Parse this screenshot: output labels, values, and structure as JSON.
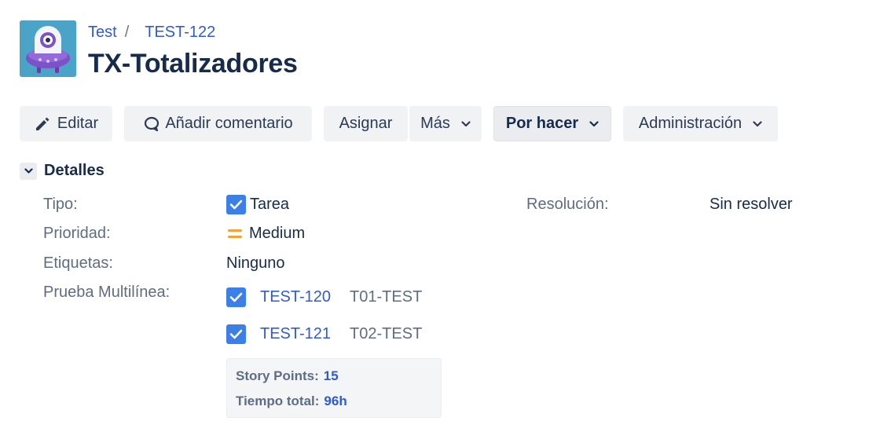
{
  "project": {
    "avatar_icon": "project-avatar-icon"
  },
  "breadcrumb": {
    "project": "Test",
    "issue_key": "TEST-122"
  },
  "issue": {
    "title": "TX-Totalizadores"
  },
  "toolbar": {
    "edit_label": "Editar",
    "comment_label": "Añadir comentario",
    "assign_label": "Asignar",
    "more_label": "Más",
    "status_label": "Por hacer",
    "admin_label": "Administración"
  },
  "details": {
    "section_title": "Detalles",
    "type_label": "Tipo:",
    "type_value": "Tarea",
    "resolution_label": "Resolución:",
    "resolution_value": "Sin resolver",
    "priority_label": "Prioridad:",
    "priority_value": "Medium",
    "labels_label": "Etiquetas:",
    "labels_value": "Ninguno",
    "multiline_label": "Prueba Multilínea:",
    "linked": [
      {
        "key": "TEST-120",
        "summary": "T01-TEST"
      },
      {
        "key": "TEST-121",
        "summary": "T02-TEST"
      }
    ],
    "story_points_label": "Story Points:",
    "story_points_value": "15",
    "time_total_label": "Tiempo total:",
    "time_total_value": "96h"
  },
  "colors": {
    "accent": "#2f5bd0",
    "checkbox": "#3c7fe6",
    "priority_medium": "#f0a23b"
  }
}
